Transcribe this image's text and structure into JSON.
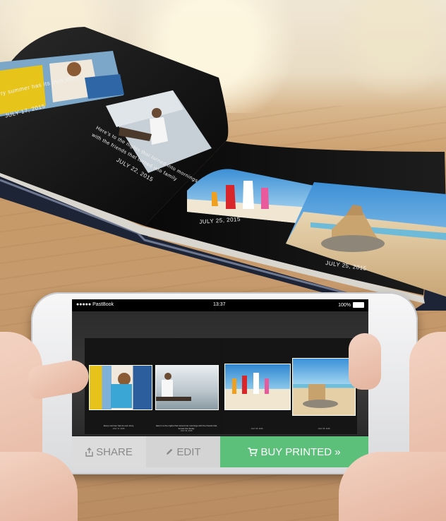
{
  "book": {
    "page1": {
      "caption": "ry summer has its own story",
      "date": "JULY 17, 2015"
    },
    "page2": {
      "caption_line1": "Here's to the nights that turned into mornings",
      "caption_line2": "with the friends that turned into family",
      "date": "JULY 22, 2015"
    },
    "page3": {
      "date": "JULY 25, 2015"
    },
    "page4": {
      "date": "JULY 25, 2015"
    }
  },
  "phone": {
    "status": {
      "carrier": "●●●●● PastBook",
      "time": "13:37",
      "battery": "100%"
    },
    "viewer": {
      "captions": [
        {
          "text": "Every summer has its own story",
          "date": "JULY 17, 2015"
        },
        {
          "text": "Here's to the nights that turned into mornings with the friends that",
          "text2": "turned into family",
          "date": "JULY 22, 2015"
        },
        {
          "text": "",
          "date": "JULY 25, 2015"
        },
        {
          "text": "",
          "date": "JULY 25, 2015"
        }
      ]
    },
    "buttons": {
      "share": "SHARE",
      "edit": "EDIT",
      "buy": "BUY PRINTED »"
    }
  },
  "colors": {
    "buy": "#5cc07a",
    "share_bg": "#dcdcdc",
    "edit_bg": "#d4d4d4",
    "book_cover": "#1c2436"
  }
}
